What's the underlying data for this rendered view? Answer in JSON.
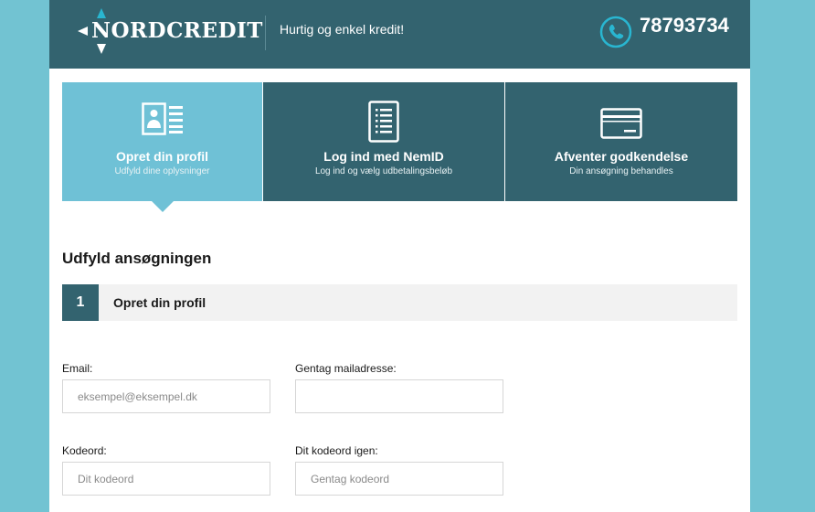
{
  "header": {
    "logo_text": "NORDCREDIT",
    "tagline": "Hurtig og enkel kredit!",
    "phone": "78793734"
  },
  "steps": [
    {
      "title": "Opret din profil",
      "subtitle": "Udfyld dine oplysninger",
      "icon": "profile-card-icon",
      "active": true
    },
    {
      "title": "Log ind med NemID",
      "subtitle": "Log ind og vælg udbetalingsbeløb",
      "icon": "document-list-icon",
      "active": false
    },
    {
      "title": "Afventer godkendelse",
      "subtitle": "Din ansøgning behandles",
      "icon": "credit-card-icon",
      "active": false
    }
  ],
  "form": {
    "title": "Udfyld ansøgningen",
    "section_number": "1",
    "section_label": "Opret din profil",
    "email_label": "Email:",
    "email_placeholder": "eksempel@eksempel.dk",
    "email_repeat_label": "Gentag mailadresse:",
    "email_repeat_placeholder": "",
    "password_label": "Kodeord:",
    "password_placeholder": "Dit kodeord",
    "password_repeat_label": "Dit kodeord igen:",
    "password_repeat_placeholder": "Gentag kodeord"
  },
  "colors": {
    "background": "#72c3d2",
    "header": "#33636f",
    "active_step": "#6fc1d6",
    "phone_icon": "#29b6d1"
  }
}
